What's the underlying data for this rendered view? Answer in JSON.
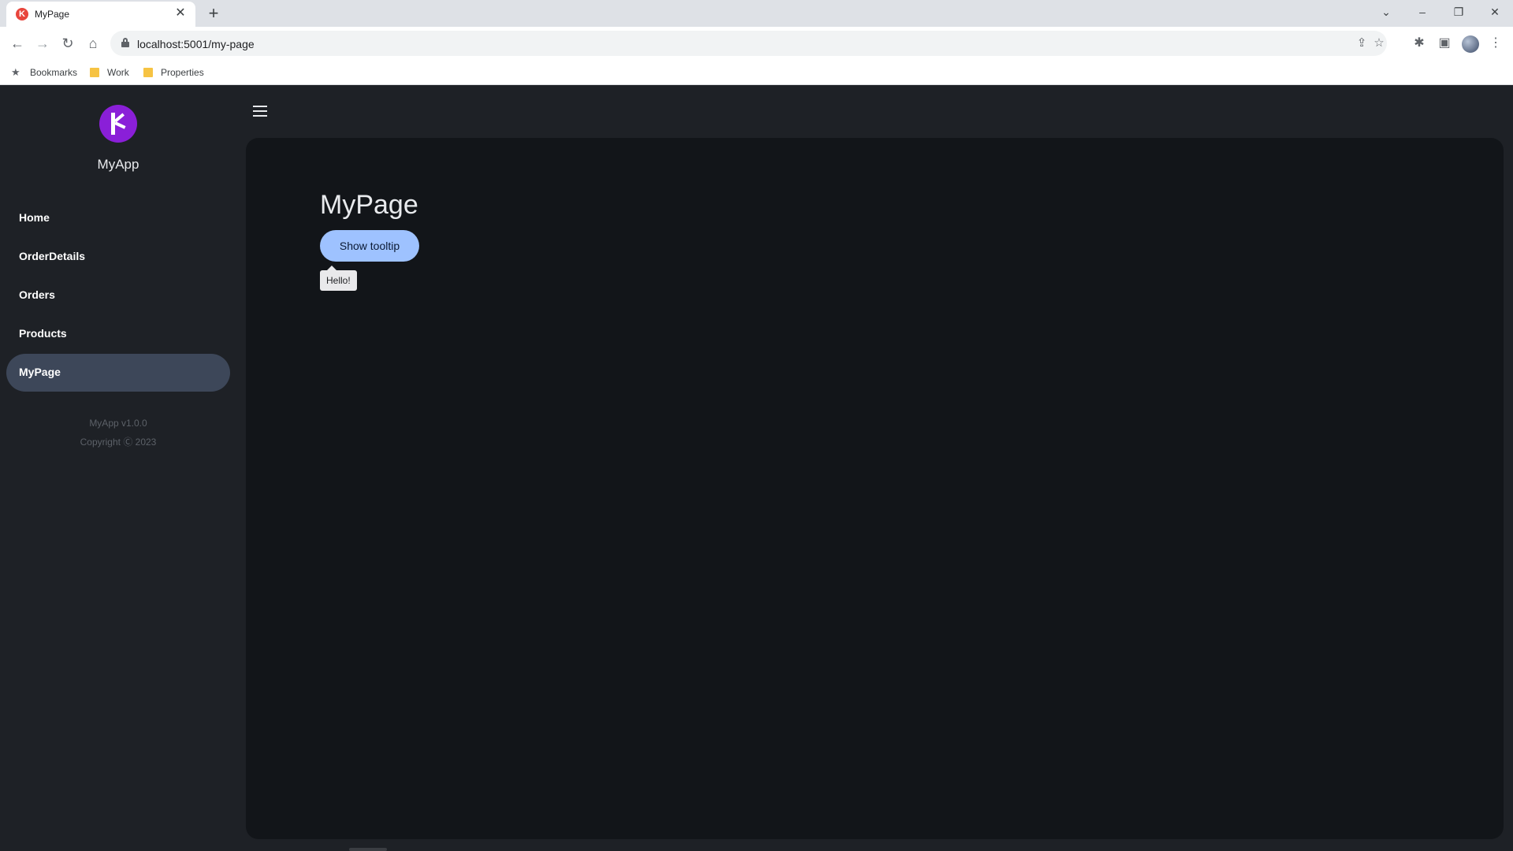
{
  "browser": {
    "tab_title": "MyPage",
    "favicon_letter": "K",
    "url": "localhost:5001/my-page",
    "bookmarks": [
      {
        "label": "Bookmarks"
      },
      {
        "label": "Work"
      },
      {
        "label": "Properties"
      }
    ]
  },
  "app": {
    "name": "MyApp",
    "nav": [
      {
        "label": "Home",
        "active": false
      },
      {
        "label": "OrderDetails",
        "active": false
      },
      {
        "label": "Orders",
        "active": false
      },
      {
        "label": "Products",
        "active": false
      },
      {
        "label": "MyPage",
        "active": true
      }
    ],
    "footer": {
      "version": "MyApp v1.0.0",
      "copyright": "Copyright Ⓒ 2023"
    }
  },
  "page": {
    "title": "MyPage",
    "button_label": "Show tooltip",
    "tooltip_text": "Hello!"
  },
  "colors": {
    "accent": "#9ec2ff",
    "logo": "#8a1fd8",
    "active_nav": "#3d4759"
  }
}
